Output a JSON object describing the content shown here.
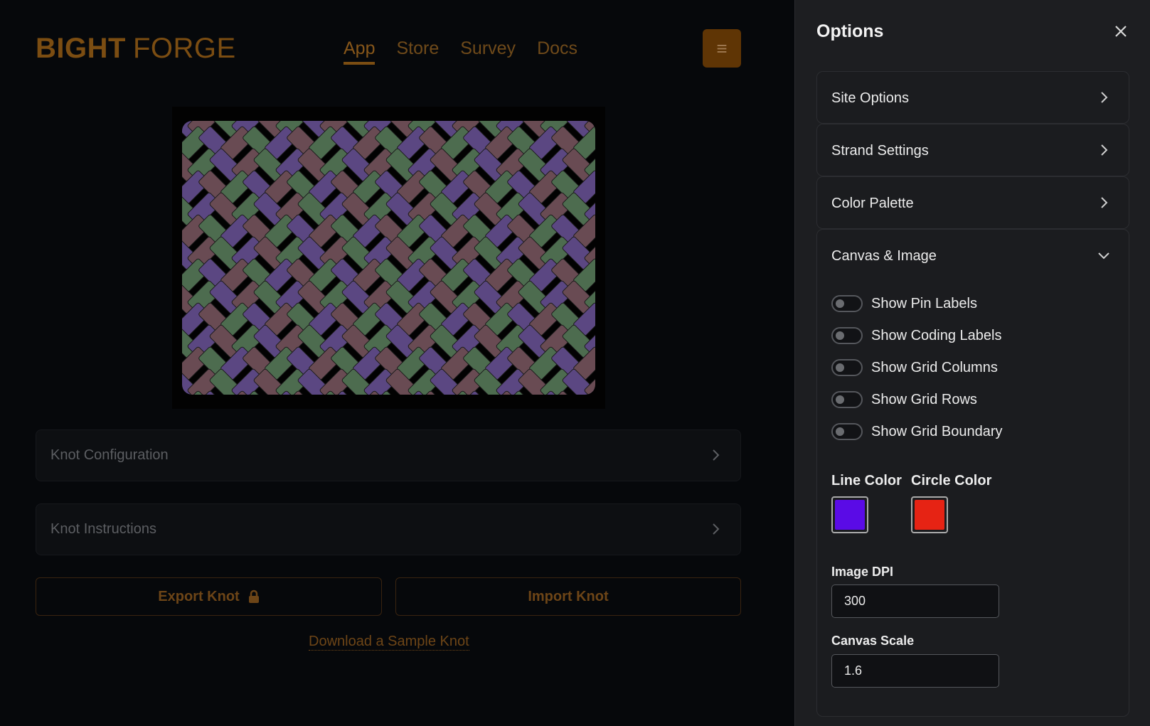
{
  "brand": {
    "part1": "BIGHT",
    "part2": "FORGE"
  },
  "nav": [
    "App",
    "Store",
    "Survey",
    "Docs"
  ],
  "menu_icon": "hamburger-icon",
  "knot": {
    "colors": [
      "#5b4782",
      "#4d6c4f",
      "#694b53"
    ]
  },
  "panels": {
    "config": "Knot Configuration",
    "instructions": "Knot Instructions"
  },
  "actions": {
    "export": "Export Knot",
    "import": "Import Knot",
    "sample": "Download a Sample Knot"
  },
  "drawer": {
    "title": "Options",
    "sections": [
      "Site Options",
      "Strand Settings",
      "Color Palette"
    ],
    "canvas_section": "Canvas & Image",
    "toggles": [
      "Show Pin Labels",
      "Show Coding Labels",
      "Show Grid Columns",
      "Show Grid Rows",
      "Show Grid Boundary"
    ],
    "line_color_label": "Line Color",
    "line_color": "#5a0be6",
    "circle_color_label": "Circle Color",
    "circle_color": "#e62314",
    "dpi_label": "Image DPI",
    "dpi_value": "300",
    "scale_label": "Canvas Scale",
    "scale_value": "1.6"
  }
}
